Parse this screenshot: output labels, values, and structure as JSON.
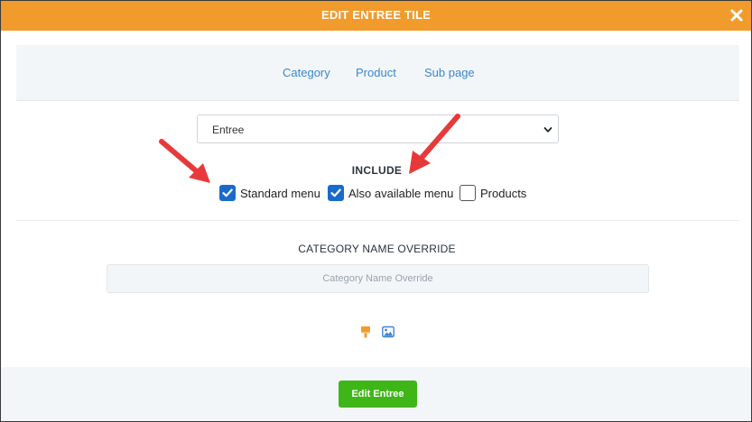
{
  "header": {
    "title": "EDIT ENTREE TILE",
    "close_icon": "close-icon"
  },
  "tabs": [
    {
      "label": "Category"
    },
    {
      "label": "Product"
    },
    {
      "label": "Sub page"
    }
  ],
  "select": {
    "value": "Entree"
  },
  "include": {
    "label": "INCLUDE",
    "options": [
      {
        "label": "Standard menu",
        "checked": true
      },
      {
        "label": "Also available menu",
        "checked": true
      },
      {
        "label": "Products",
        "checked": false
      }
    ]
  },
  "override": {
    "label": "CATEGORY NAME OVERRIDE",
    "placeholder": "Category Name Override",
    "value": ""
  },
  "icons": {
    "brush": "paintbrush-icon",
    "image": "image-icon"
  },
  "footer": {
    "submit_label": "Edit Entree"
  },
  "colors": {
    "header": "#f19b2c",
    "link": "#3b86d1",
    "checkbox": "#1a6bc9",
    "submit": "#3fb618",
    "annotation_arrow": "#e8393a"
  }
}
